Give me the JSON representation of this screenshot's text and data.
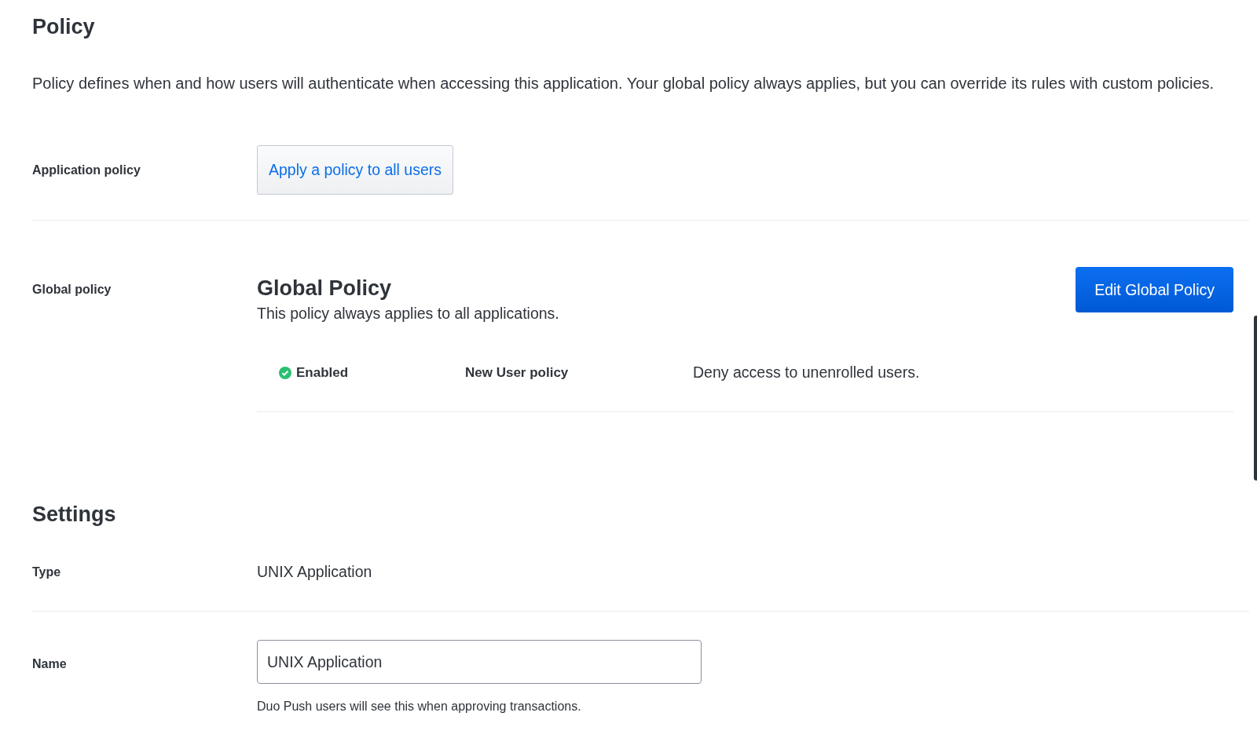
{
  "policy": {
    "title": "Policy",
    "description": "Policy defines when and how users will authenticate when accessing this application. Your global policy always applies, but you can override its rules with custom policies.",
    "application_policy": {
      "label": "Application policy",
      "button": "Apply a policy to all users"
    },
    "global_policy": {
      "label": "Global policy",
      "heading": "Global Policy",
      "subtitle": "This policy always applies to all applications.",
      "button": "Edit Global Policy",
      "rules": [
        {
          "status": "Enabled",
          "enabled": true,
          "name": "New User policy",
          "value": "Deny access to unenrolled users."
        }
      ]
    }
  },
  "settings": {
    "title": "Settings",
    "fields": [
      {
        "kind": "text",
        "label": "Type",
        "value": "UNIX Application"
      },
      {
        "kind": "input",
        "label": "Name",
        "value": "UNIX Application",
        "help": "Duo Push users will see this when approving transactions."
      }
    ]
  }
}
